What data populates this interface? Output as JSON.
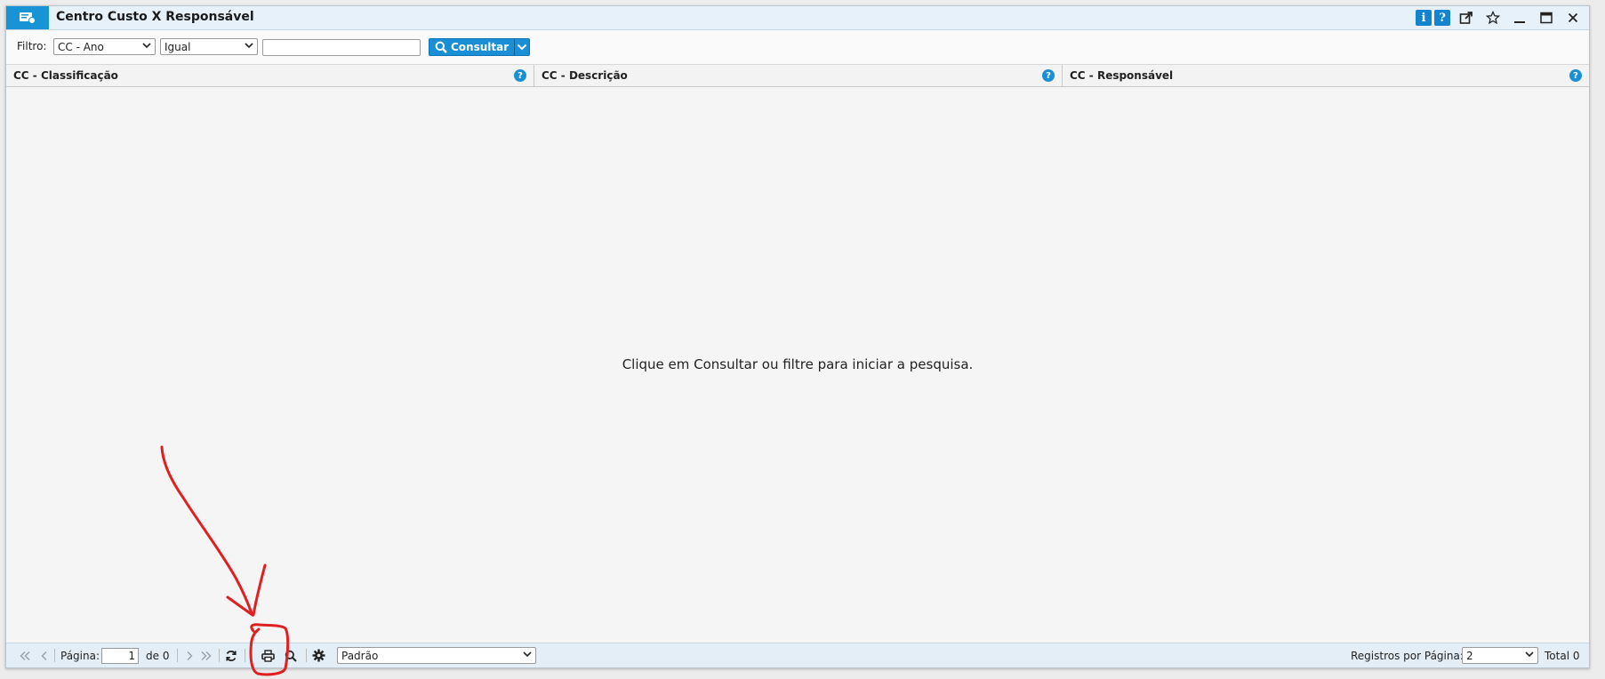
{
  "window": {
    "title": "Centro Custo X Responsável",
    "info_label": "i",
    "help_label": "?"
  },
  "filter": {
    "label": "Filtro:",
    "field_select": "CC - Ano",
    "operator_select": "Igual",
    "value": "",
    "consultar_label": "Consultar"
  },
  "grid": {
    "columns": [
      {
        "label": "CC - Classificação"
      },
      {
        "label": "CC - Descrição"
      },
      {
        "label": "CC - Responsável"
      }
    ],
    "help_glyph": "?",
    "empty_message": "Clique em Consultar ou filtre para iniciar a pesquisa."
  },
  "pager": {
    "page_label": "Página:",
    "page_value": "1",
    "of_label": "de 0",
    "layout_select": "Padrão",
    "per_page_label": "Registros por Página:",
    "per_page_value": "2",
    "total_label": "Total 0"
  },
  "colors": {
    "accent": "#1a8fd6",
    "titlebar": "#e6f1f9",
    "annotation": "#e02020"
  },
  "icons": [
    "window-app-icon",
    "info-icon",
    "help-icon",
    "share-icon",
    "star-icon",
    "minimize-icon",
    "maximize-icon",
    "close-icon",
    "search-icon",
    "chevron-down-icon",
    "first-page-icon",
    "prev-page-icon",
    "next-page-icon",
    "last-page-icon",
    "refresh-icon",
    "print-icon",
    "zoom-icon",
    "gear-icon"
  ]
}
